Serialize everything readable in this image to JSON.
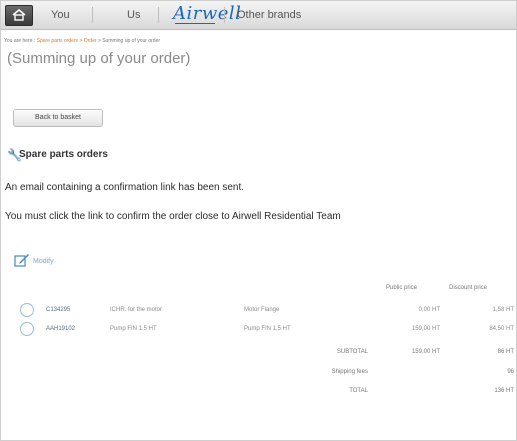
{
  "nav": {
    "tabs": [
      "You",
      "Us"
    ],
    "brand": "Airwell",
    "other_brands": "Other brands"
  },
  "breadcrumb": {
    "prefix": "You are here : ",
    "link": "Spare parts orders > Order",
    "current": " > Summing up of your order"
  },
  "page": {
    "title": "(Summing up of your order)",
    "back_button": "Back to basket"
  },
  "section": {
    "title": "Spare parts orders"
  },
  "messages": {
    "line1": "An email containing a confirmation link has been sent.",
    "line2": "You must click the link to confirm the order close to Airwell Residential Team"
  },
  "edit": {
    "label": "Modify"
  },
  "table": {
    "headers": [
      "Public price",
      "Discount price"
    ],
    "rows": [
      {
        "ref": "C134295",
        "desc": "ICHR. for the motor",
        "model": "Motor Flange",
        "public": "0,00 HT",
        "discount": "1,58 HT"
      },
      {
        "ref": "AAH19102",
        "desc": "Pump FIN 1.5 HT",
        "model": "Pump FIN 1.5 HT",
        "public": "159,00 HT",
        "discount": "84,50 HT"
      }
    ],
    "summary": [
      {
        "label": "SUBTOTAL",
        "public": "159,00 HT",
        "discount": "86 HT"
      },
      {
        "label": "Shipping fees",
        "public": "",
        "discount": "96"
      },
      {
        "label": "TOTAL",
        "public": "",
        "discount": "136 HT"
      }
    ]
  }
}
